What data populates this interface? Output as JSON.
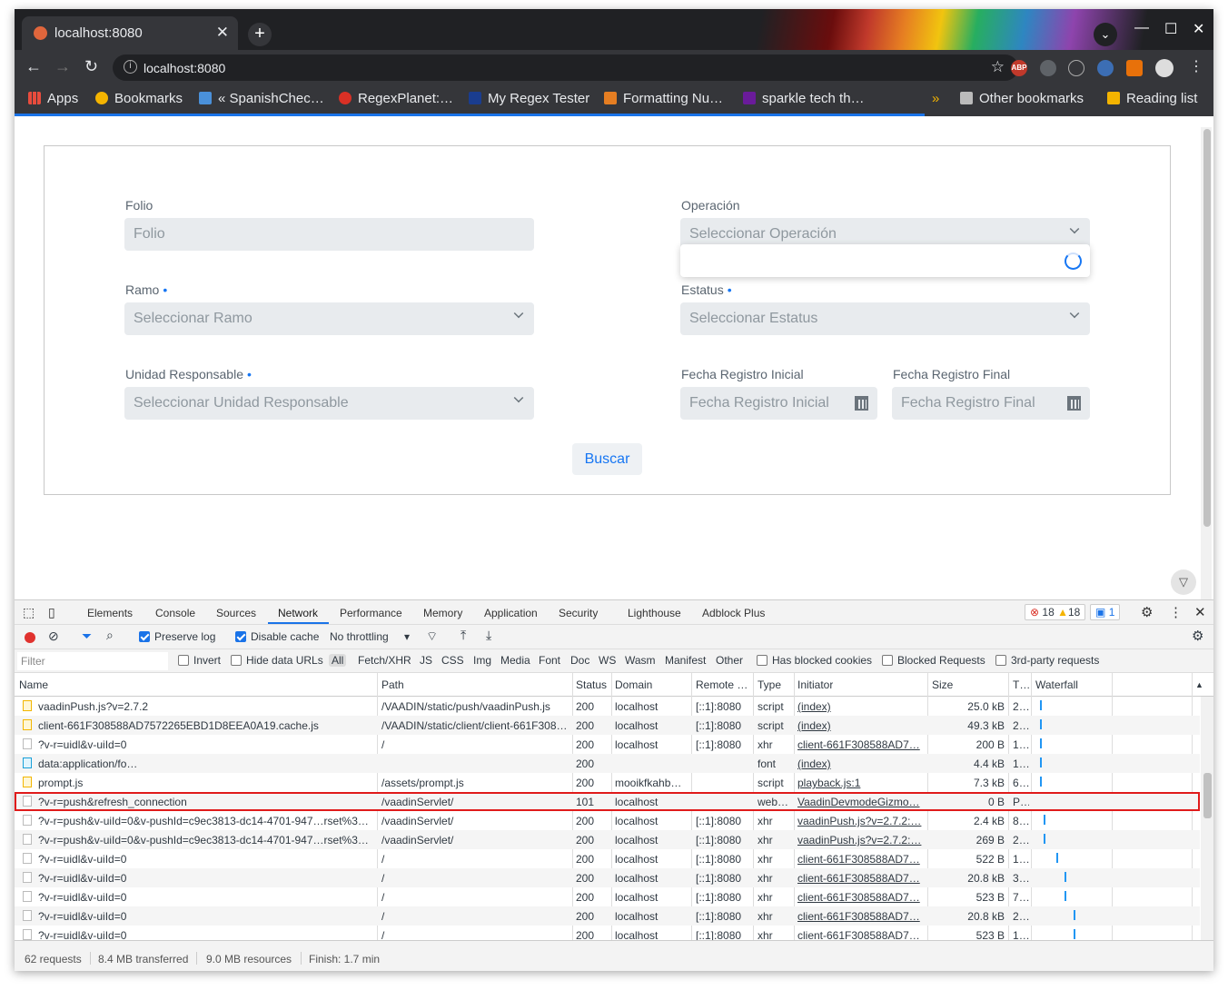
{
  "browser": {
    "tab_title": "localhost:8080",
    "url": "localhost:8080",
    "bookmarks": [
      "Apps",
      "Bookmarks",
      "« SpanishChec…",
      "RegexPlanet:…",
      "My Regex Tester",
      "Formatting Nu…",
      "sparkle tech th…"
    ],
    "other_bookmarks": "Other bookmarks",
    "reading_list": "Reading list",
    "ext_abp": "ABP"
  },
  "form": {
    "folio_label": "Folio",
    "folio_placeholder": "Folio",
    "operacion_label": "Operación",
    "operacion_placeholder": "Seleccionar Operación",
    "ramo_label": "Ramo",
    "ramo_placeholder": "Seleccionar Ramo",
    "estatus_label": "Estatus",
    "estatus_placeholder": "Seleccionar Estatus",
    "unidad_label": "Unidad Responsable",
    "unidad_placeholder": "Seleccionar Unidad Responsable",
    "fecha_inicial_label": "Fecha Registro Inicial",
    "fecha_inicial_placeholder": "Fecha Registro Inicial",
    "fecha_final_label": "Fecha Registro Final",
    "fecha_final_placeholder": "Fecha Registro Final",
    "required_marker": "•",
    "buscar": "Buscar"
  },
  "devtools": {
    "tabs": [
      "Elements",
      "Console",
      "Sources",
      "Network",
      "Performance",
      "Memory",
      "Application",
      "Security",
      "Lighthouse",
      "Adblock Plus"
    ],
    "active_tab": "Network",
    "errors": "18",
    "warnings": "18",
    "messages": "1",
    "preserve_log": "Preserve log",
    "disable_cache": "Disable cache",
    "throttling": "No throttling",
    "filter_placeholder": "Filter",
    "invert": "Invert",
    "hide_data_urls": "Hide data URLs",
    "type_filters": [
      "All",
      "Fetch/XHR",
      "JS",
      "CSS",
      "Img",
      "Media",
      "Font",
      "Doc",
      "WS",
      "Wasm",
      "Manifest",
      "Other"
    ],
    "has_blocked_cookies": "Has blocked cookies",
    "blocked_requests": "Blocked Requests",
    "third_party": "3rd-party requests",
    "columns": [
      "Name",
      "Path",
      "Status",
      "Domain",
      "Remote …",
      "Type",
      "Initiator",
      "Size",
      "T…",
      "Waterfall"
    ],
    "rows": [
      {
        "name": "vaadinPush.js?v=2.7.2",
        "path": "/VAADIN/static/push/vaadinPush.js",
        "status": "200",
        "domain": "localhost",
        "remote": "[::1]:8080",
        "type": "script",
        "initiator": "(index)",
        "size": "25.0 kB",
        "time": "2…",
        "icon": "js",
        "wf": 0.03
      },
      {
        "name": "client-661F308588AD7572265EBD1D8EEA0A19.cache.js",
        "path": "/VAADIN/static/client/client-661F308…",
        "status": "200",
        "domain": "localhost",
        "remote": "[::1]:8080",
        "type": "script",
        "initiator": "(index)",
        "size": "49.3 kB",
        "time": "2…",
        "icon": "js",
        "wf": 0.03
      },
      {
        "name": "?v-r=uidl&v-uiId=0",
        "path": "/",
        "status": "200",
        "domain": "localhost",
        "remote": "[::1]:8080",
        "type": "xhr",
        "initiator": "client-661F308588AD7…",
        "size": "200 B",
        "time": "1…",
        "icon": "doc",
        "wf": 0.03
      },
      {
        "name": "data:application/fo…",
        "path": "",
        "status": "200",
        "domain": "",
        "remote": "",
        "type": "font",
        "initiator": "(index)",
        "size": "4.4 kB",
        "time": "1…",
        "icon": "font",
        "wf": 0.03
      },
      {
        "name": "prompt.js",
        "path": "/assets/prompt.js",
        "status": "200",
        "domain": "mooikfkahb…",
        "remote": "",
        "type": "script",
        "initiator": "playback.js:1",
        "size": "7.3 kB",
        "time": "6…",
        "icon": "js",
        "wf": 0.03
      },
      {
        "name": "?v-r=push&refresh_connection",
        "path": "/vaadinServlet/",
        "status": "101",
        "domain": "localhost",
        "remote": "",
        "type": "web…",
        "initiator": "VaadinDevmodeGizmo…",
        "size": "0 B",
        "time": "P…",
        "icon": "doc",
        "wf": null,
        "highlight": true
      },
      {
        "name": "?v-r=push&v-uiId=0&v-pushId=c9ec3813-dc14-4701-947…rset%3…",
        "path": "/vaadinServlet/",
        "status": "200",
        "domain": "localhost",
        "remote": "[::1]:8080",
        "type": "xhr",
        "initiator": "vaadinPush.js?v=2.7.2:…",
        "size": "2.4 kB",
        "time": "8…",
        "icon": "doc",
        "wf": 0.05
      },
      {
        "name": "?v-r=push&v-uiId=0&v-pushId=c9ec3813-dc14-4701-947…rset%3…",
        "path": "/vaadinServlet/",
        "status": "200",
        "domain": "localhost",
        "remote": "[::1]:8080",
        "type": "xhr",
        "initiator": "vaadinPush.js?v=2.7.2:…",
        "size": "269 B",
        "time": "2…",
        "icon": "doc",
        "wf": 0.05
      },
      {
        "name": "?v-r=uidl&v-uiId=0",
        "path": "/",
        "status": "200",
        "domain": "localhost",
        "remote": "[::1]:8080",
        "type": "xhr",
        "initiator": "client-661F308588AD7…",
        "size": "522 B",
        "time": "1…",
        "icon": "doc",
        "wf": 0.13
      },
      {
        "name": "?v-r=uidl&v-uiId=0",
        "path": "/",
        "status": "200",
        "domain": "localhost",
        "remote": "[::1]:8080",
        "type": "xhr",
        "initiator": "client-661F308588AD7…",
        "size": "20.8 kB",
        "time": "3…",
        "icon": "doc",
        "wf": 0.18
      },
      {
        "name": "?v-r=uidl&v-uiId=0",
        "path": "/",
        "status": "200",
        "domain": "localhost",
        "remote": "[::1]:8080",
        "type": "xhr",
        "initiator": "client-661F308588AD7…",
        "size": "523 B",
        "time": "7…",
        "icon": "doc",
        "wf": 0.18
      },
      {
        "name": "?v-r=uidl&v-uiId=0",
        "path": "/",
        "status": "200",
        "domain": "localhost",
        "remote": "[::1]:8080",
        "type": "xhr",
        "initiator": "client-661F308588AD7…",
        "size": "20.8 kB",
        "time": "2…",
        "icon": "doc",
        "wf": 0.24
      },
      {
        "name": "?v-r=uidl&v-uiId=0",
        "path": "/",
        "status": "200",
        "domain": "localhost",
        "remote": "[::1]:8080",
        "type": "xhr",
        "initiator": "client-661F308588AD7…",
        "size": "523 B",
        "time": "1…",
        "icon": "doc",
        "wf": 0.24
      }
    ],
    "summary": {
      "requests": "62 requests",
      "transferred": "8.4 MB transferred",
      "resources": "9.0 MB resources",
      "finish": "Finish: 1.7 min"
    }
  }
}
